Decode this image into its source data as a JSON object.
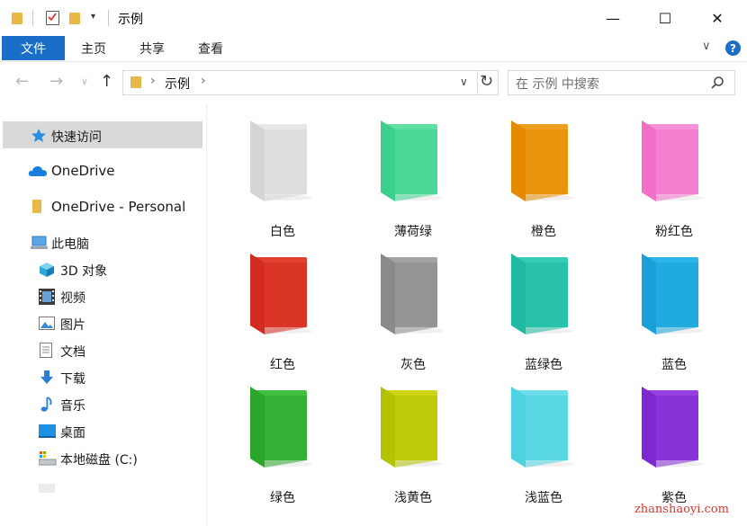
{
  "window": {
    "title": "示例",
    "minimize": "—",
    "maximize": "☐",
    "close": "✕"
  },
  "ribbon": {
    "tabs": [
      "文件",
      "主页",
      "共享",
      "查看"
    ],
    "expand": "∨",
    "help": "?"
  },
  "address": {
    "crumbs": [
      "示例"
    ],
    "separator": "›",
    "dropdown": "∨",
    "refresh": "↻"
  },
  "search": {
    "placeholder": "在 示例 中搜索"
  },
  "sidebar": {
    "items": [
      {
        "label": "快速访问",
        "icon": "star-icon"
      },
      {
        "label": "OneDrive",
        "icon": "cloud-icon"
      },
      {
        "label": "OneDrive - Personal",
        "icon": "folder-icon"
      },
      {
        "label": "此电脑",
        "icon": "computer-icon"
      },
      {
        "label": "3D 对象",
        "icon": "cube-icon"
      },
      {
        "label": "视频",
        "icon": "film-icon"
      },
      {
        "label": "图片",
        "icon": "picture-icon"
      },
      {
        "label": "文档",
        "icon": "document-icon"
      },
      {
        "label": "下载",
        "icon": "download-icon"
      },
      {
        "label": "音乐",
        "icon": "music-icon"
      },
      {
        "label": "桌面",
        "icon": "desktop-icon"
      },
      {
        "label": "本地磁盘 (C:)",
        "icon": "drive-icon"
      }
    ]
  },
  "folders": [
    {
      "name": "白色",
      "front": "#d4d4d4",
      "back": "#e8e8e8"
    },
    {
      "name": "薄荷绿",
      "front": "#3dcf8e",
      "back": "#5ee0a3"
    },
    {
      "name": "橙色",
      "front": "#e68a00",
      "back": "#f0a020"
    },
    {
      "name": "粉红色",
      "front": "#f070c8",
      "back": "#f890d8"
    },
    {
      "name": "红色",
      "front": "#d42b20",
      "back": "#e24030"
    },
    {
      "name": "灰色",
      "front": "#8a8a8a",
      "back": "#a2a2a2"
    },
    {
      "name": "蓝绿色",
      "front": "#1fb8a0",
      "back": "#33cdb5"
    },
    {
      "name": "蓝色",
      "front": "#1aa0d8",
      "back": "#2bb5e8"
    },
    {
      "name": "绿色",
      "front": "#2aa62a",
      "back": "#40bf40"
    },
    {
      "name": "浅黄色",
      "front": "#b5c200",
      "back": "#cbd514"
    },
    {
      "name": "浅蓝色",
      "front": "#4dd2e0",
      "back": "#6cdeea"
    },
    {
      "name": "紫色",
      "front": "#7d28d0",
      "back": "#9540e0"
    }
  ],
  "watermark": "zhanshaoyi.com"
}
